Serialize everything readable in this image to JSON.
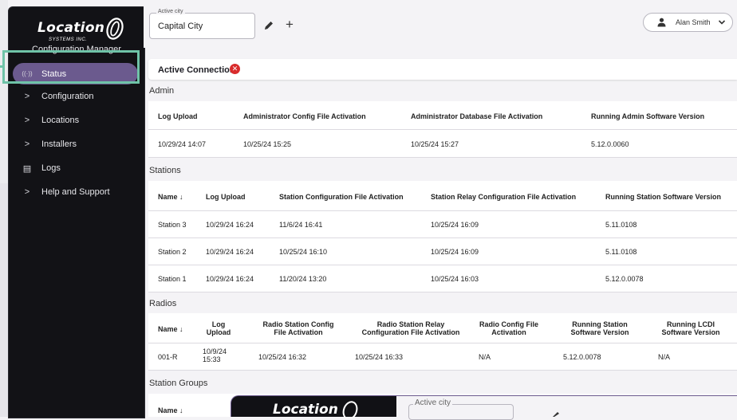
{
  "brand": {
    "logo_text": "Location",
    "logo_sub": "SYSTEMS INC.",
    "app_name": "Configuration Manager"
  },
  "sidebar": {
    "items": [
      {
        "label": "Status",
        "icon": "broadcast-icon",
        "glyph": "((·))",
        "active": true
      },
      {
        "label": "Configuration",
        "icon": "chevron-right-icon",
        "glyph": ">"
      },
      {
        "label": "Locations",
        "icon": "chevron-right-icon",
        "glyph": ">"
      },
      {
        "label": "Installers",
        "icon": "chevron-right-icon",
        "glyph": ">"
      },
      {
        "label": "Logs",
        "icon": "log-list-icon",
        "glyph": "▤"
      },
      {
        "label": "Help and Support",
        "icon": "chevron-right-icon",
        "glyph": ">"
      }
    ]
  },
  "topbar": {
    "city_legend": "Active city",
    "city_value": "Capital City",
    "plus": "+",
    "user_name": "Alan Smith"
  },
  "connection": {
    "label": "Active Connection:",
    "status_glyph": "✕",
    "status_color": "#d92c2c"
  },
  "admin": {
    "title": "Admin",
    "headers": [
      "Log Upload",
      "Administrator Config File Activation",
      "Administrator Database File Activation",
      "Running Admin Software Version"
    ],
    "rows": [
      [
        "10/29/24 14:07",
        "10/25/24 15:25",
        "10/25/24 15:27",
        "5.12.0.0060"
      ]
    ]
  },
  "stations": {
    "title": "Stations",
    "headers": [
      "Name",
      "Log Upload",
      "Station Configuration File Activation",
      "Station Relay Configuration File Activation",
      "Running Station Software Version"
    ],
    "sort_glyph": "↓",
    "rows": [
      [
        "Station 3",
        "10/29/24 16:24",
        "11/6/24 16:41",
        "10/25/24 16:09",
        "5.11.0108"
      ],
      [
        "Station 2",
        "10/29/24 16:24",
        "10/25/24 16:10",
        "10/25/24 16:09",
        "5.11.0108"
      ],
      [
        "Station 1",
        "10/29/24 16:24",
        "11/20/24 13:20",
        "10/25/24 16:03",
        "5.12.0.0078"
      ]
    ]
  },
  "radios": {
    "title": "Radios",
    "headers": [
      [
        "Name"
      ],
      [
        "Log",
        "Upload"
      ],
      [
        "Radio Station Config",
        "File Activation"
      ],
      [
        "Radio Station Relay",
        "Configuration File Activation"
      ],
      [
        "Radio Config File",
        "Activation"
      ],
      [
        "Running Station",
        "Software Version"
      ],
      [
        "Running LCDI",
        "Software Version"
      ]
    ],
    "sort_glyph": "↓",
    "rows": [
      [
        "001-R",
        "10/9/24",
        "15:33",
        "10/25/24 16:32",
        "10/25/24 16:33",
        "N/A",
        "5.12.0.0078",
        "N/A"
      ]
    ]
  },
  "station_groups": {
    "title": "Station Groups",
    "headers": [
      "Name"
    ],
    "sort_glyph": "↓"
  },
  "overlay": {
    "logo_text": "Location",
    "city_legend": "Active city"
  },
  "colors": {
    "sidebar_bg": "#121216",
    "active_item": "#6b5a8e",
    "highlight": "#6fc3a8",
    "error": "#d92c2c"
  }
}
